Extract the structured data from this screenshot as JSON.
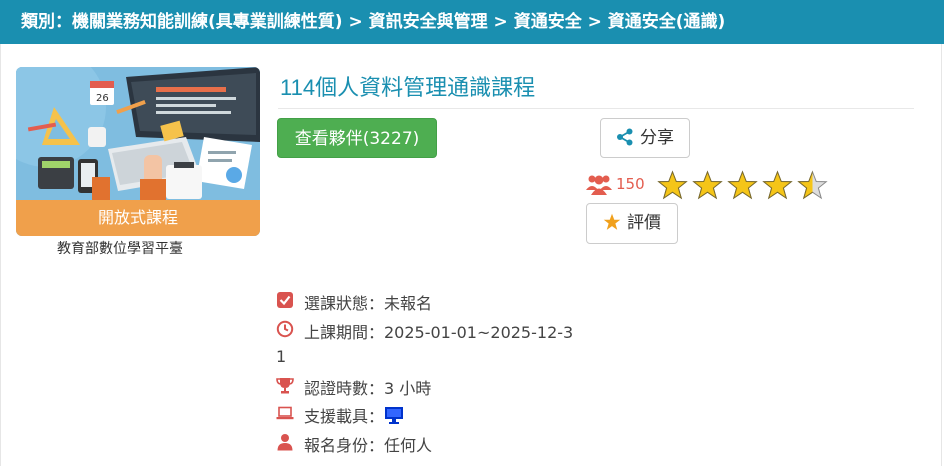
{
  "category_bar": {
    "text": "類別：機關業務知能訓練(具專業訓練性質) > 資訊安全與管理 > 資通安全 > 資通安全(通識)"
  },
  "thumbnail": {
    "banner": "開放式課程",
    "calendar_text": "26"
  },
  "provider": "教育部數位學習平臺",
  "course": {
    "title": "114個人資料管理通識課程"
  },
  "buttons": {
    "partners": "查看夥伴(3227)",
    "share": "分享",
    "rate": "評價"
  },
  "rating": {
    "learners": "150",
    "stars": 4.5,
    "max_stars": 5
  },
  "info": {
    "enroll_status": "選課狀態：未報名",
    "period_line1": "上課期間：2025-01-01~2025-12-3",
    "period_line2": "1",
    "hours": "認證時數：3 小時",
    "device_label": "支援載具：",
    "identity": "報名身份：任何人"
  },
  "colors": {
    "brand": "#1a8fb0",
    "green": "#4eae51",
    "orange": "#f0a04b",
    "red": "#e35d4f",
    "star": "#f5c518",
    "device_blue": "#0033cc"
  },
  "icons": [
    "share-icon",
    "users-icon",
    "star-icon",
    "check-square-icon",
    "clock-icon",
    "trophy-icon",
    "laptop-icon",
    "user-icon",
    "desktop-icon"
  ]
}
